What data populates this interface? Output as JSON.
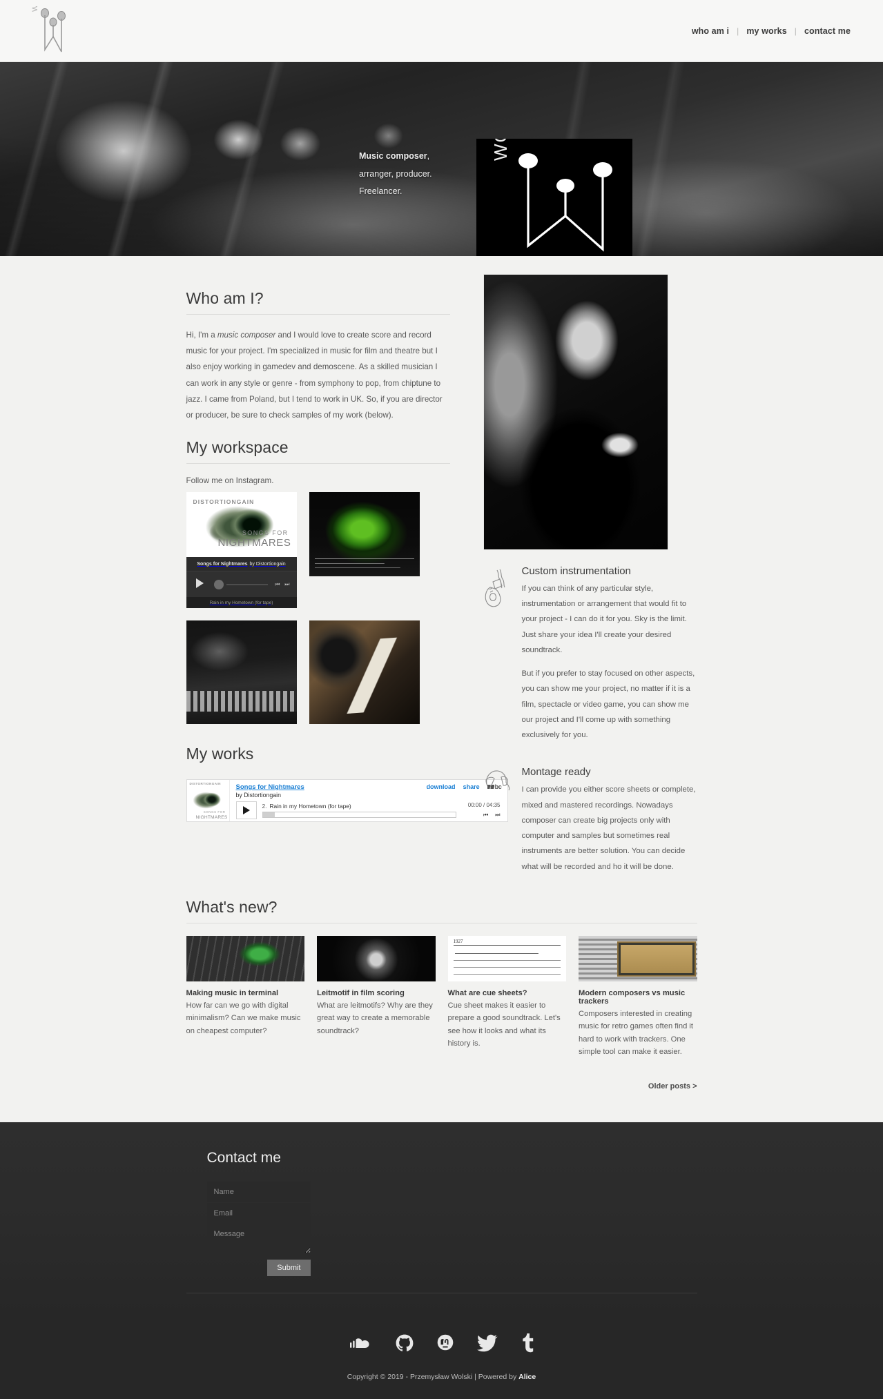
{
  "site": {
    "brand_logo_text": "WOLSKI"
  },
  "topnav": {
    "items": [
      {
        "label": "who am i"
      },
      {
        "label": "my works"
      },
      {
        "label": "contact me"
      }
    ],
    "separator": "|"
  },
  "hero": {
    "tagline_bold": "Music composer",
    "tagline_bold_tail": ",",
    "tagline_line2": "arranger, producer.",
    "tagline_line3": "Freelancer.",
    "logo_text": "WOLSKI"
  },
  "who_am_i": {
    "heading": "Who am I?",
    "intro_prefix": "Hi, I'm a ",
    "intro_em": "music composer",
    "intro_rest": " and I would love to create score and record music for your project. I'm specialized in music for film and theatre but I also enjoy working in gamedev and demoscene. As a skilled musician I can work in any style or genre - from symphony to pop, from chiptune to jazz. I came from Poland, but I tend to work in UK. So, if you are director or producer, be sure to check samples of my work (below)."
  },
  "workspace": {
    "heading": "My workspace",
    "note": "Follow me on Instagram.",
    "tiles": [
      {
        "name": "bandcamp-embed-tile",
        "artist": "DISTORTIONGAIN",
        "line1": "SONGS FOR",
        "line2": "NIGHTMARES",
        "bar_bold": "Songs for Nightmares",
        "bar_rest": "by Distortiongain",
        "foot": "Rain in my Hometown (for tape)"
      },
      {
        "name": "album-art-green-tile"
      },
      {
        "name": "studio-photo-tile"
      },
      {
        "name": "guitar-photo-tile"
      }
    ]
  },
  "services": [
    {
      "icon": "guitar-icon",
      "title": "Custom instrumentation",
      "paragraphs": [
        "If you can think of any particular style, instrumentation or arrangement that would fit to your project - I can do it for you. Sky is the limit. Just share your idea I'll create your desired soundtrack.",
        "But if you prefer to stay focused on other aspects, you can show me your project, no matter if it is a film, spectacle or video game, you can show me our project and I'll come up with something exclusively for you."
      ]
    },
    {
      "icon": "headphones-icon",
      "title": "Montage ready",
      "paragraphs": [
        "I can provide you either score sheets or complete, mixed and mastered recordings. Nowadays composer can create big projects only with computer and samples but sometimes real instruments are better solution. You can decide what will be recorded and ho it will be done."
      ]
    }
  ],
  "my_works": {
    "heading": "My works",
    "player": {
      "album_title": "Songs for Nightmares",
      "artist_line": "by Distortiongain",
      "download_label": "download",
      "share_label": "share",
      "logo_label": "bc",
      "track_number": "2.",
      "track_name": "Rain in my Hometown (for tape)",
      "time": "00:00 / 04:35",
      "prev_icon": "skip-back-icon",
      "next_icon": "skip-forward-icon",
      "art_artist": "DISTORTIONGAIN",
      "art_line1": "SONGS FOR",
      "art_line2": "NIGHTMARES"
    }
  },
  "whats_new": {
    "heading": "What's new?",
    "posts": [
      {
        "thumb": "raspberry-pi-keyboard-thumb",
        "title": "Making music in terminal",
        "desc": "How far can we go with digital minimalism? Can we make music on cheapest computer?"
      },
      {
        "thumb": "dark-figure-thumb",
        "title": "Leitmotif in film scoring",
        "desc": "What are leitmotifs? Why are they great way to create a memorable soundtrack?"
      },
      {
        "thumb": "metropolis-score-thumb",
        "title": "What are cue sheets?",
        "desc": "Cue sheet makes it easier to prepare a good soundtrack. Let's see how it looks and what its history is."
      },
      {
        "thumb": "music-tracker-thumb",
        "title": "Modern composers vs music trackers",
        "desc": "Composers interested in creating music for retro games often find it hard to work with trackers. One simple tool can make it easier."
      }
    ],
    "older_posts_label": "Older posts >"
  },
  "contact": {
    "heading": "Contact me",
    "name_placeholder": "Name",
    "email_placeholder": "Email",
    "message_placeholder": "Message",
    "name_value": "",
    "email_value": "",
    "message_value": "",
    "submit_label": "Submit"
  },
  "footer": {
    "socials": [
      {
        "name": "soundcloud-icon"
      },
      {
        "name": "github-icon"
      },
      {
        "name": "mastodon-icon"
      },
      {
        "name": "twitter-icon"
      },
      {
        "name": "tumblr-icon"
      }
    ],
    "copyright_prefix": "Copyright © 2019 - Przemysław Wolski | Powered by ",
    "copyright_brand": "Alice"
  },
  "colors": {
    "page_bg": "#f2f2f0",
    "header_bg": "#f7f7f6",
    "text": "#585858",
    "heading": "#3a3a3a",
    "dark_section": "#2b2b2b",
    "link_blue": "#1a7fd4"
  }
}
